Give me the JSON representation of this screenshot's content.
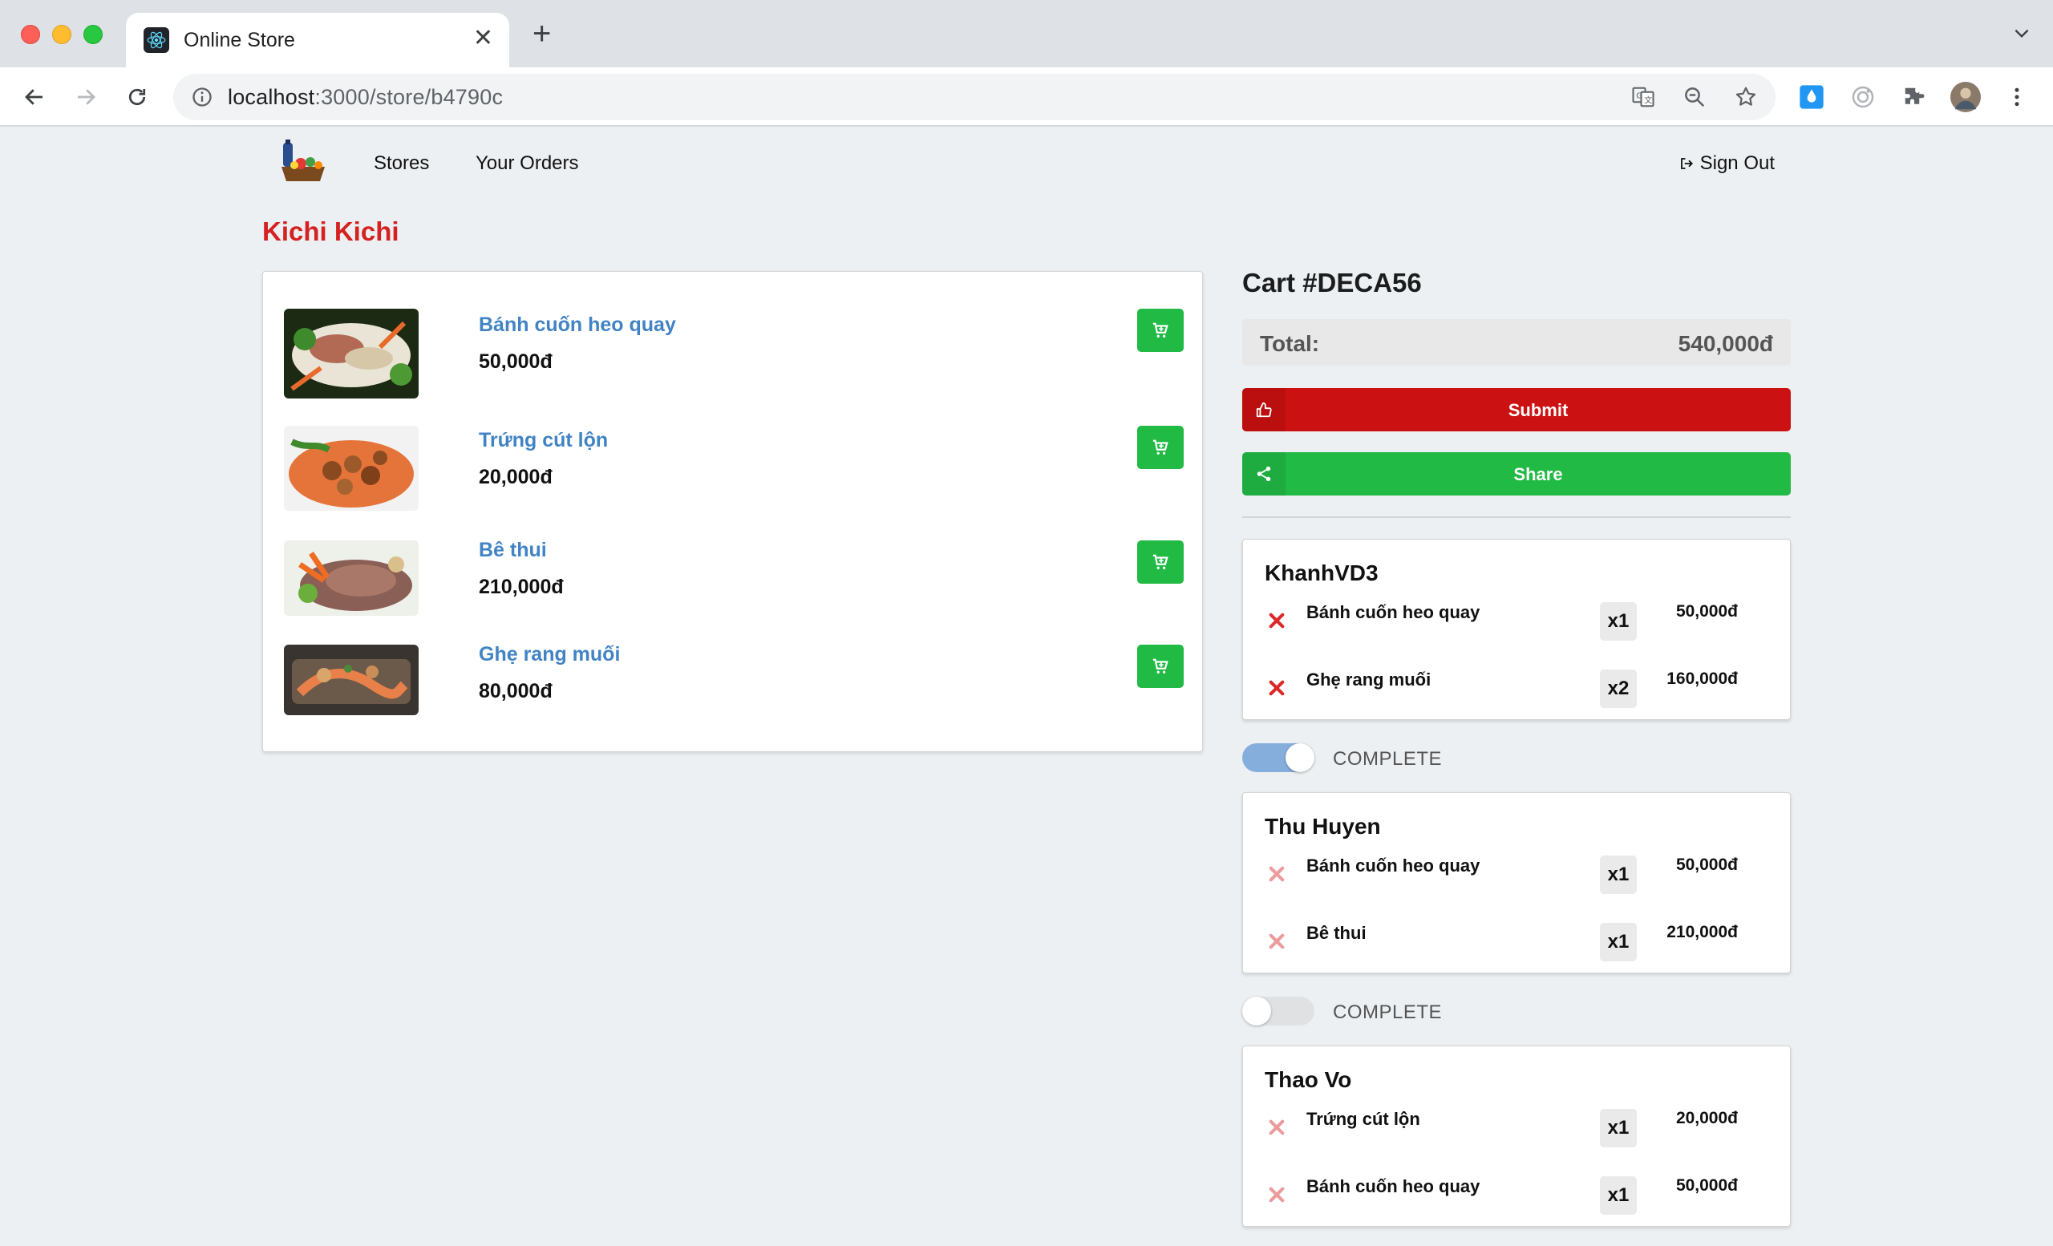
{
  "browser": {
    "tab_title": "Online Store",
    "url_host": "localhost",
    "url_path": ":3000/store/b4790c"
  },
  "nav": {
    "stores": "Stores",
    "orders": "Your Orders",
    "sign_out": "Sign Out"
  },
  "store": {
    "name": "Kichi Kichi",
    "products": [
      {
        "name": "Bánh cuốn heo quay",
        "price": "50,000đ"
      },
      {
        "name": "Trứng cút lộn",
        "price": "20,000đ"
      },
      {
        "name": "Bê thui",
        "price": "210,000đ"
      },
      {
        "name": "Ghẹ rang muối",
        "price": "80,000đ"
      }
    ]
  },
  "cart": {
    "title": "Cart #DECA56",
    "total_label": "Total:",
    "total_value": "540,000đ",
    "submit_label": "Submit",
    "share_label": "Share",
    "complete_label": "COMPLETE",
    "orders": [
      {
        "user": "KhanhVD3",
        "complete": true,
        "items": [
          {
            "name": "Bánh cuốn heo quay",
            "qty": "x1",
            "price": "50,000đ"
          },
          {
            "name": "Ghẹ rang muối",
            "qty": "x2",
            "price": "160,000đ"
          }
        ]
      },
      {
        "user": "Thu Huyen",
        "complete": false,
        "items": [
          {
            "name": "Bánh cuốn heo quay",
            "qty": "x1",
            "price": "50,000đ"
          },
          {
            "name": "Bê thui",
            "qty": "x1",
            "price": "210,000đ"
          }
        ]
      },
      {
        "user": "Thao Vo",
        "complete": false,
        "items": [
          {
            "name": "Trứng cút lộn",
            "qty": "x1",
            "price": "20,000đ"
          },
          {
            "name": "Bánh cuốn heo quay",
            "qty": "x1",
            "price": "50,000đ"
          }
        ]
      }
    ]
  },
  "colors": {
    "brand_red": "#d52121",
    "submit_red": "#cb1111",
    "green": "#21ba45",
    "link_blue": "#4183c4",
    "toggle_on": "#86aedc"
  }
}
